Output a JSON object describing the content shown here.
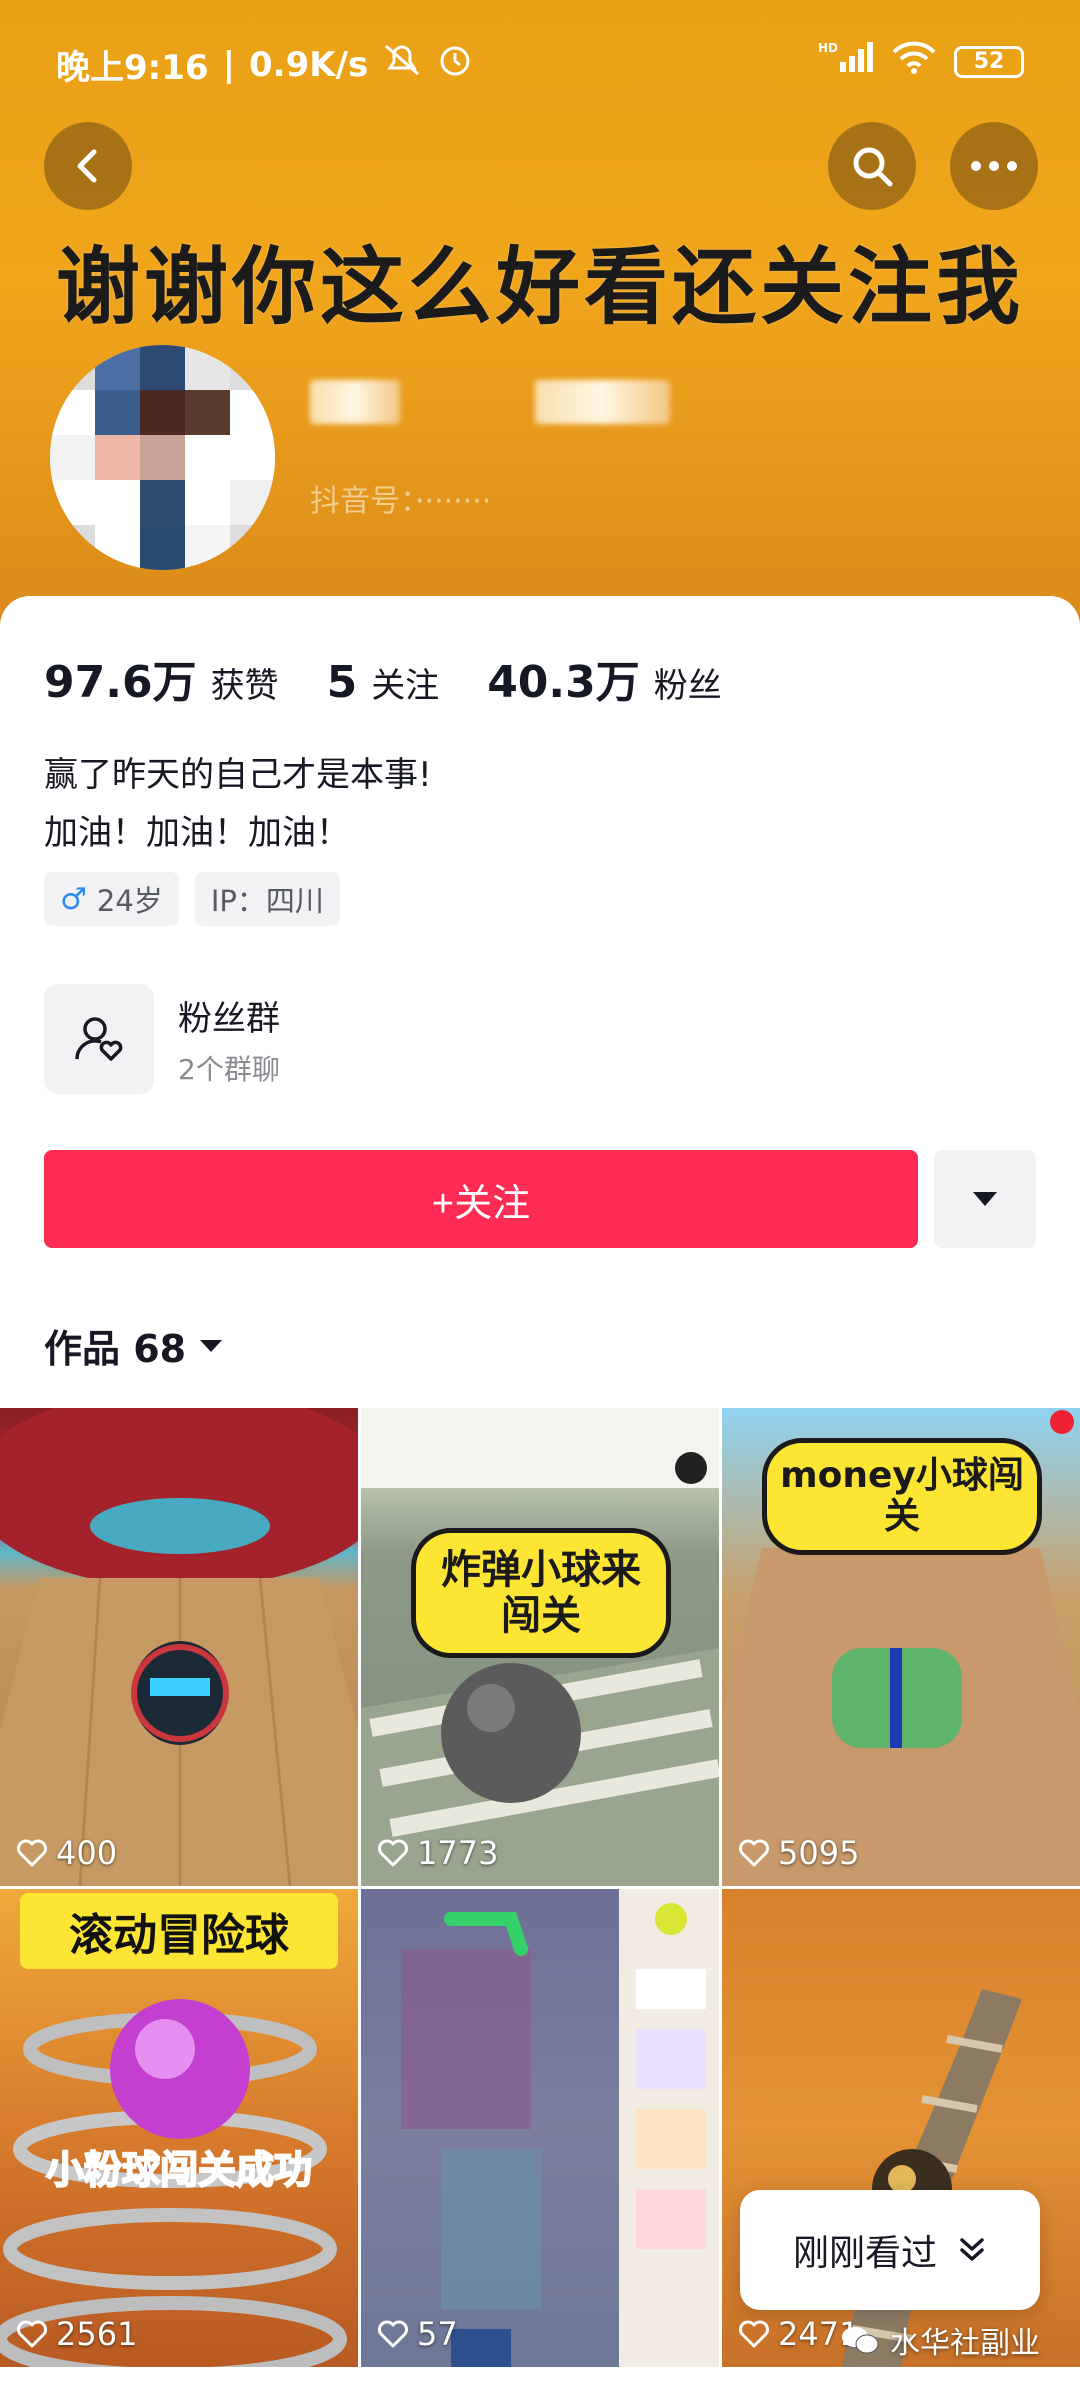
{
  "status_bar": {
    "time": "晚上9:16",
    "speed": "0.9K/s",
    "battery": "52",
    "network": "HD"
  },
  "header": {
    "banner_text": "谢谢你这么好看还关注我",
    "colors": {
      "banner": "#efa31a",
      "accent": "#fe2c55"
    }
  },
  "profile": {
    "stats": [
      {
        "value": "97.6万",
        "label": "获赞"
      },
      {
        "value": "5",
        "label": "关注"
      },
      {
        "value": "40.3万",
        "label": "粉丝"
      }
    ],
    "bio": [
      "赢了昨天的自己才是本事!",
      "加油！加油！加油！"
    ],
    "tags": [
      {
        "icon": "male-icon",
        "text": "24岁"
      },
      {
        "text": "IP：四川"
      }
    ],
    "fan_group": {
      "title": "粉丝群",
      "subtitle": "2个群聊"
    },
    "follow_label": "+关注",
    "works_label": "作品 68"
  },
  "videos": [
    {
      "likes": "400"
    },
    {
      "likes": "1773",
      "caption": "炸弹小球来闯关"
    },
    {
      "likes": "5095",
      "caption": "money小球闯关"
    },
    {
      "likes": "2561",
      "caption_top": "滚动冒险球",
      "caption_bottom": "小粉球闯关成功"
    },
    {
      "likes": "57"
    },
    {
      "likes": "2471"
    }
  ],
  "recent_label": "刚刚看过",
  "watermark": "水华社副业"
}
